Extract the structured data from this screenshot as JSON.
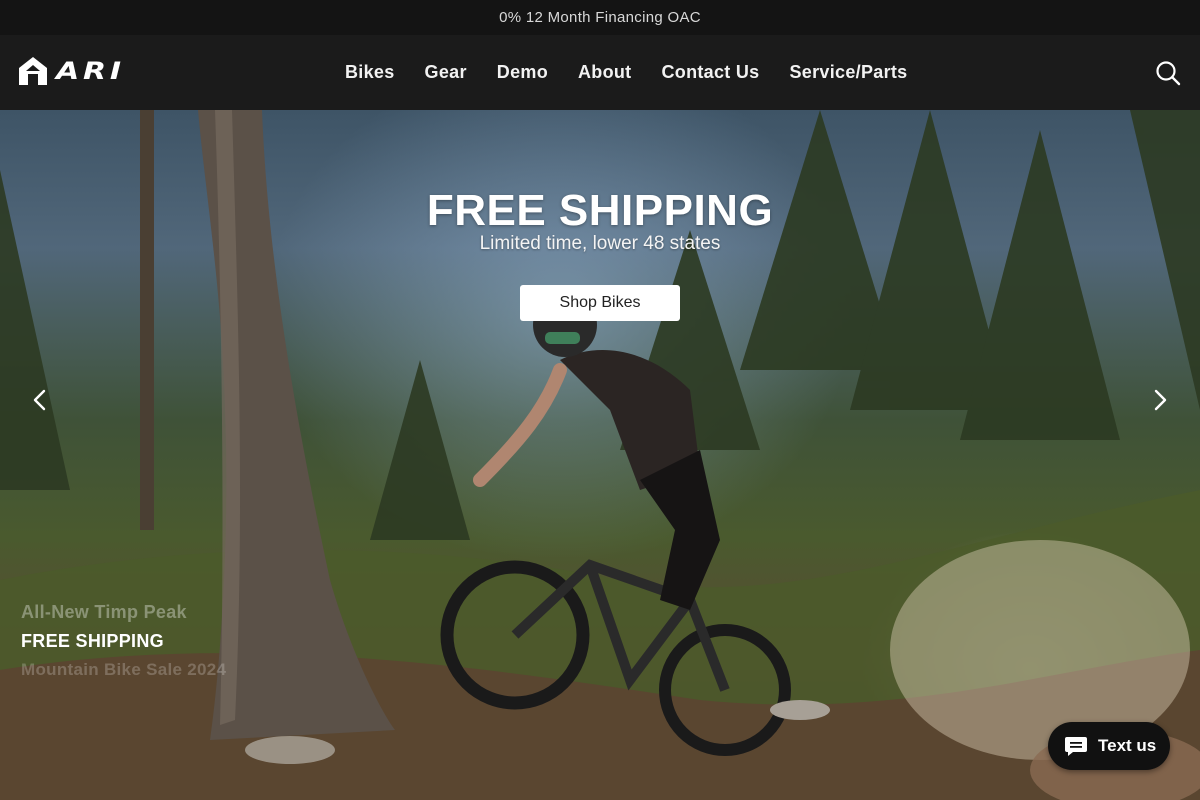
{
  "announcement": {
    "text": "0% 12 Month Financing OAC"
  },
  "header": {
    "logo_text": "ARI",
    "nav": [
      {
        "label": "Bikes"
      },
      {
        "label": "Gear"
      },
      {
        "label": "Demo"
      },
      {
        "label": "About"
      },
      {
        "label": "Contact Us"
      },
      {
        "label": "Service/Parts"
      }
    ],
    "search_icon": "search-icon"
  },
  "hero": {
    "title": "FREE SHIPPING",
    "subtitle": "Limited time, lower 48 states",
    "button_label": "Shop Bikes",
    "prev_icon": "chevron-left-icon",
    "next_icon": "chevron-right-icon",
    "captions": {
      "previous": "All-New Timp Peak",
      "current": "FREE SHIPPING",
      "next": "Mountain Bike Sale 2024"
    }
  },
  "chat": {
    "label": "Text us",
    "icon": "chat-bubble-icon"
  },
  "colors": {
    "topbar": "#141414",
    "header": "#1b1b1b",
    "button_bg": "#ffffff",
    "chat_bg": "#111111"
  }
}
